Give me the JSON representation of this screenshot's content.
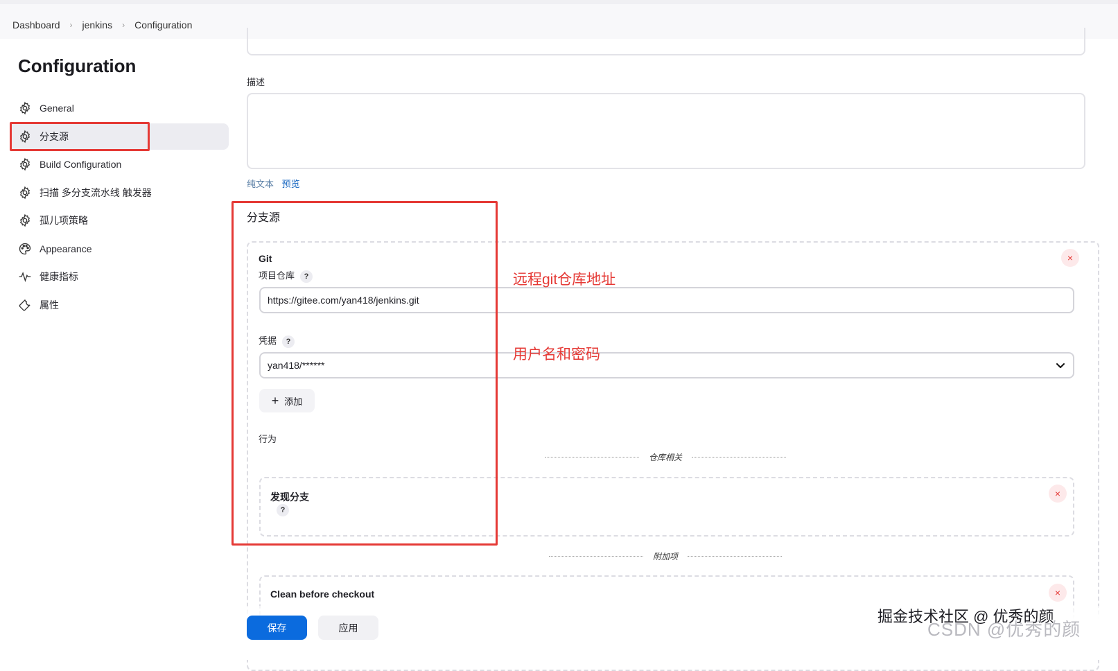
{
  "breadcrumb": {
    "items": [
      "Dashboard",
      "jenkins",
      "Configuration"
    ]
  },
  "sidebar": {
    "title": "Configuration",
    "items": [
      {
        "label": "General",
        "icon": "gear-icon"
      },
      {
        "label": "分支源",
        "icon": "gear-icon",
        "active": true
      },
      {
        "label": "Build Configuration",
        "icon": "gear-icon"
      },
      {
        "label": "扫描 多分支流水线 触发器",
        "icon": "gear-icon"
      },
      {
        "label": "孤儿项策略",
        "icon": "gear-icon"
      },
      {
        "label": "Appearance",
        "icon": "palette-icon"
      },
      {
        "label": "健康指标",
        "icon": "pulse-icon"
      },
      {
        "label": "属性",
        "icon": "wrench-icon"
      }
    ]
  },
  "form": {
    "description_label": "描述",
    "description_value": "",
    "plain_text_link": "纯文本",
    "preview_link": "预览",
    "branch_source_heading": "分支源",
    "git": {
      "title": "Git",
      "repo_label": "项目仓库",
      "repo_value": "https://gitee.com/yan418/jenkins.git",
      "cred_label": "凭据",
      "cred_value": "yan418/******",
      "add_label": "添加",
      "behaviors_label": "行为",
      "repo_related_divider": "仓库相关",
      "discover_branches": "发现分支",
      "extras_divider": "附加项",
      "clean_before_checkout": "Clean before checkout"
    },
    "help_symbol": "?",
    "close_symbol": "×"
  },
  "annotations": {
    "repo_note": "远程git仓库地址",
    "cred_note": "用户名和密码"
  },
  "actions": {
    "save": "保存",
    "apply": "应用"
  },
  "watermark": {
    "juejin": "掘金技术社区 @ 优秀的颜",
    "csdn": "CSDN @优秀的颜"
  },
  "colors": {
    "primary": "#0b6bde",
    "annotation_red": "#e53935",
    "active_bg": "#ececf1"
  }
}
